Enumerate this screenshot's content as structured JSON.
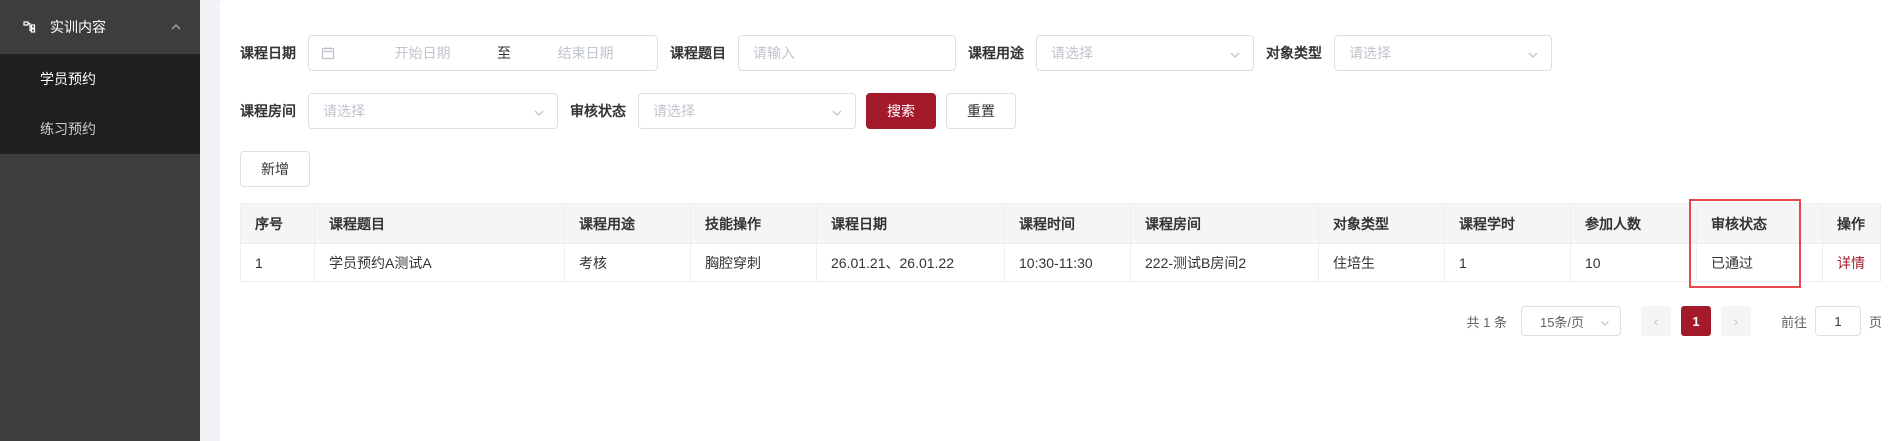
{
  "sidebar": {
    "group_label": "实训内容",
    "items": [
      {
        "label": "学员预约",
        "active": true
      },
      {
        "label": "练习预约",
        "active": false
      }
    ]
  },
  "filters": {
    "date_label": "课程日期",
    "date_start_placeholder": "开始日期",
    "date_separator": "至",
    "date_end_placeholder": "结束日期",
    "topic_label": "课程题目",
    "topic_placeholder": "请输入",
    "purpose_label": "课程用途",
    "purpose_placeholder": "请选择",
    "object_label": "对象类型",
    "object_placeholder": "请选择",
    "room_label": "课程房间",
    "room_placeholder": "请选择",
    "status_label": "审核状态",
    "status_placeholder": "请选择",
    "search_label": "搜索",
    "reset_label": "重置"
  },
  "toolbar": {
    "add_label": "新增"
  },
  "table": {
    "columns": [
      "序号",
      "课程题目",
      "课程用途",
      "技能操作",
      "课程日期",
      "课程时间",
      "课程房间",
      "对象类型",
      "课程学时",
      "参加人数",
      "审核状态",
      "操作"
    ],
    "rows": [
      [
        "1",
        "学员预约A测试A",
        "考核",
        "胸腔穿刺",
        "26.01.21、26.01.22",
        "10:30-11:30",
        "222-测试B房间2",
        "住培生",
        "1",
        "10",
        "已通过",
        "详情"
      ]
    ]
  },
  "pagination": {
    "total_text": "共 1 条",
    "page_size": "15条/页",
    "prev": "‹",
    "current_page": "1",
    "next": "›",
    "goto_label": "前往",
    "goto_value": "1",
    "page_suffix": "页"
  },
  "colors": {
    "accent": "#a31a2b",
    "highlight": "#e5484d",
    "sidebar_bg": "#3d3d3d",
    "submenu_bg": "#1f1f1f"
  }
}
